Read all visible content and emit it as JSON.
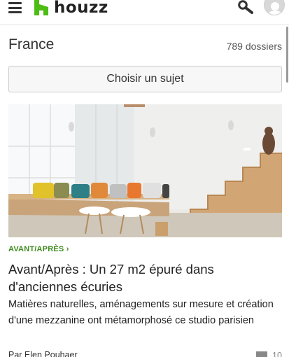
{
  "header": {
    "menu_icon": "hamburger-menu-icon",
    "logo_text": "houzz",
    "brand_color": "#4dbc15",
    "search_icon": "search-icon",
    "avatar_icon": "user-avatar-icon"
  },
  "listing": {
    "country": "France",
    "count": "789 dossiers",
    "topic_button": "Choisir un sujet"
  },
  "article": {
    "image_alt": "living room with wooden staircase and bench",
    "category": "AVANT/APRÈS",
    "category_color": "#3d8b1e",
    "title": "Avant/Après : Un 27 m2 épuré dans d'anciennes écuries",
    "summary": "Matières naturelles, aménagements sur mesure et création d'une mezzanine ont métamorphosé ce studio parisien",
    "author": "Par Elen Pouhaer",
    "comment_count": "10"
  }
}
